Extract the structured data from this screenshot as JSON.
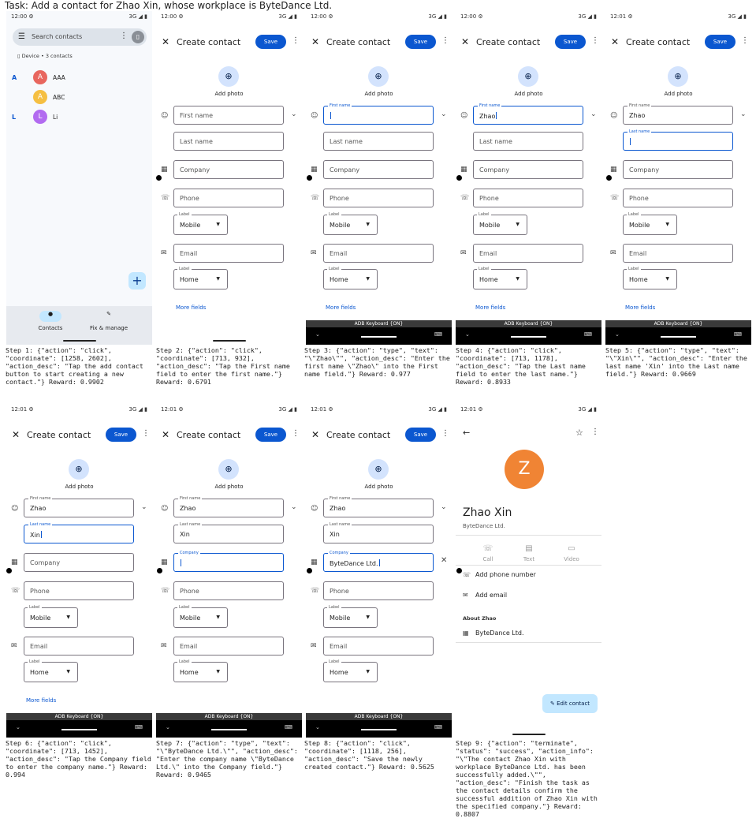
{
  "task": "Task:  Add a contact for Zhao Xin, whose workplace is ByteDance Ltd.",
  "status": {
    "signal": "3G ◢ ▮",
    "times": [
      "12:00 ⚙",
      "12:00 ⚙",
      "12:00 ⚙",
      "12:00 ⚙",
      "12:01 ⚙",
      "12:01 ⚙",
      "12:01 ⚙",
      "12:01 ⚙",
      "12:01 ⚙"
    ]
  },
  "contacts": {
    "search_placeholder": "Search contacts",
    "device_line": "Device • 3 contacts",
    "rows": [
      {
        "letter": "A",
        "avatar": "A",
        "name": "AAA",
        "color": "#e8665e"
      },
      {
        "letter": "",
        "avatar": "A",
        "name": "ABC",
        "color": "#f5bf42"
      },
      {
        "letter": "L",
        "avatar": "L",
        "name": "Li",
        "color": "#b26bf0"
      }
    ],
    "nav_contacts": "Contacts",
    "nav_fix": "Fix & manage",
    "fab": "+"
  },
  "form": {
    "title": "Create contact",
    "save": "Save",
    "add_photo": "Add photo",
    "first_name_ph": "First name",
    "first_name_tag": "First name",
    "last_name_ph": "Last name",
    "last_name_tag": "Last name",
    "company_ph": "Company",
    "company_tag": "Company",
    "phone_ph": "Phone",
    "label_tag": "Label",
    "mobile": "Mobile",
    "email_ph": "Email",
    "home": "Home",
    "more_fields": "More fields",
    "keyboard": "ADB Keyboard {ON}"
  },
  "values": {
    "zhao": "Zhao",
    "xin": "Xin",
    "company": "ByteDance Ltd."
  },
  "detail": {
    "avatar": "Z",
    "name": "Zhao Xin",
    "company": "ByteDance Ltd.",
    "call": "Call",
    "text": "Text",
    "video": "Video",
    "add_phone": "Add phone number",
    "add_email": "Add email",
    "about": "About Zhao",
    "about_company": "ByteDance Ltd.",
    "edit": "Edit contact"
  },
  "captions": [
    "Step 1: {\"action\": \"click\", \"coordinate\": [1258, 2602], \"action_desc\": \"Tap the add contact button to start creating a new contact.\"} Reward: 0.9902",
    "Step 2: {\"action\": \"click\", \"coordinate\": [713, 932], \"action_desc\": \"Tap the First name field to enter the first name.\"} Reward: 0.6791",
    "Step 3: {\"action\": \"type\", \"text\": \"\\\"Zhao\\\"\", \"action_desc\": \"Enter the first name \\\"Zhao\\\" into the First name field.\"} Reward: 0.977",
    "Step 4: {\"action\": \"click\", \"coordinate\": [713, 1178], \"action_desc\": \"Tap the Last name field to enter the last name.\"} Reward: 0.8933",
    "Step 5: {\"action\": \"type\", \"text\": \"\\\"Xin\\\"\", \"action_desc\": \"Enter the last name 'Xin' into the Last name field.\"} Reward: 0.9669",
    "Step 6: {\"action\": \"click\", \"coordinate\": [713, 1452], \"action_desc\": \"Tap the Company field to enter the company name.\"} Reward: 0.994",
    "Step 7: {\"action\": \"type\", \"text\": \"\\\"ByteDance Ltd.\\\"\", \"action_desc\": \"Enter the company name \\\"ByteDance Ltd.\\\" into the Company field.\"} Reward: 0.9465",
    "Step 8: {\"action\": \"click\", \"coordinate\": [1118, 256], \"action_desc\": \"Save the newly created contact.\"} Reward: 0.5625",
    "Step 9: {\"action\": \"terminate\", \"status\": \"success\", \"action_info\": \"\\\"The contact Zhao Xin with workplace ByteDance Ltd. has been successfully added.\\\"\", \"action_desc\": \"Finish the task as the contact details confirm the successful addition of Zhao Xin with the specified company.\"} Reward: 0.8807"
  ]
}
